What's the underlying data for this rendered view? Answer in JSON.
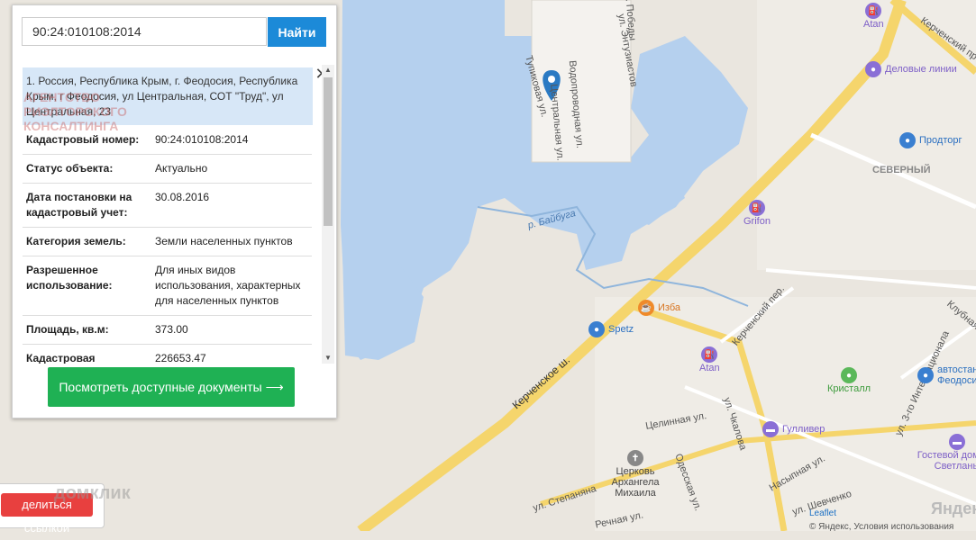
{
  "search": {
    "value": "90:24:010108:2014",
    "button_label": "Найти"
  },
  "info": {
    "address": "1. Россия, Республика Крым, г. Феодосия, Республика Крым, г Феодосия, ул Центральная, СОТ \"Труд\", ул Центральная, 23",
    "close_glyph": "✕",
    "rows": [
      {
        "key": "Кадастровый номер:",
        "value": "90:24:010108:2014"
      },
      {
        "key": "Статус объекта:",
        "value": "Актуально"
      },
      {
        "key": "Дата постановки на кадастровый учет:",
        "value": "30.08.2016"
      },
      {
        "key": "Категория земель:",
        "value": "Земли населенных пунктов"
      },
      {
        "key": "Разрешенное использование:",
        "value": "Для иных видов использования, характерных для населенных пунктов"
      },
      {
        "key": "Площадь, кв.м:",
        "value": "373.00"
      },
      {
        "key": "Кадастровая стоимость:",
        "value": "226653.47"
      }
    ]
  },
  "docs_button": "Посмотреть доступные документы ⟶",
  "share_button": "делиться ссылкой",
  "watermark": {
    "lines": [
      "АГЕНТСТВО",
      "РИЭЛТОРСКОГО",
      "КОНСАЛТИНГА"
    ],
    "bottom": "домклик"
  },
  "map": {
    "streets": [
      "Тупиковая ул.",
      "ул. Энтузиастов",
      "ул. Победы",
      "Водопроводная ул.",
      "Центральная ул.",
      "р. Байбуга",
      "Керченское ш.",
      "Керченский пер.",
      "Целинная ул.",
      "ул. Чкалова",
      "Одесская ул.",
      "ул. Степанянa",
      "Насыпная ул.",
      "ул. Шевченко",
      "Речная ул.",
      "ул. 3-го Интернационала",
      "Клубная ул.",
      "Керченский пр-д"
    ],
    "areas": [
      "СЕВЕРНЫЙ"
    ],
    "pois": [
      {
        "name": "Atan",
        "icon": "gas-station-icon"
      },
      {
        "name": "Деловые линии",
        "icon": "shop-icon"
      },
      {
        "name": "Продторг",
        "icon": "shop-icon"
      },
      {
        "name": "Grifon",
        "icon": "gas-station-icon"
      },
      {
        "name": "Изба",
        "icon": "cafe-icon"
      },
      {
        "name": "Spetz",
        "icon": "shop-icon"
      },
      {
        "name": "Atan",
        "icon": "gas-station-icon"
      },
      {
        "name": "Кристалл",
        "icon": "bus-stop-icon"
      },
      {
        "name": "Гулливер",
        "icon": "hotel-icon"
      },
      {
        "name": "автостанция Феодосия",
        "icon": "bus-icon"
      },
      {
        "name": "Гостевой домик у Светланы",
        "icon": "hotel-icon"
      },
      {
        "name": "Церковь Архангела Михаила",
        "icon": "church-icon"
      }
    ],
    "attribution": "© Яндекс, Условия использования",
    "leaflet": "Leaflet",
    "yandex": "Яндекс"
  }
}
